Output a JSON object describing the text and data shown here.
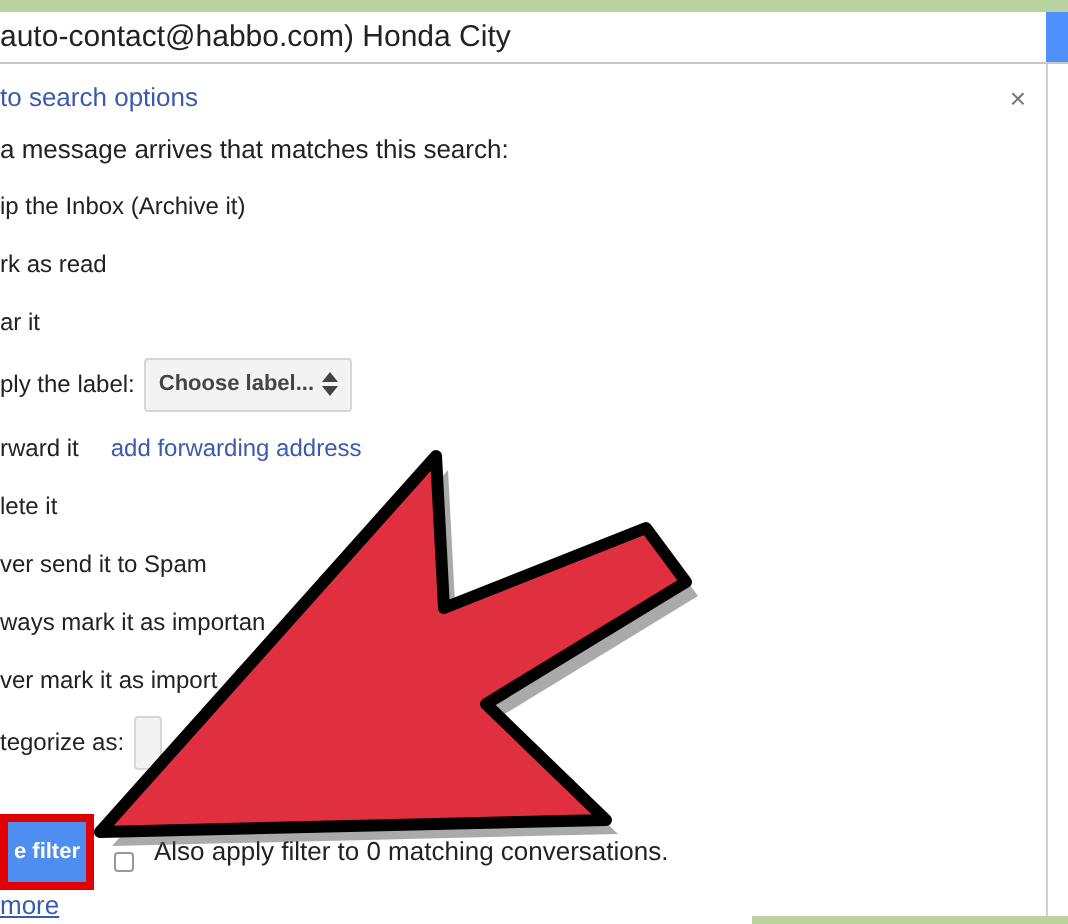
{
  "search": {
    "value": "auto-contact@habbo.com) Honda City"
  },
  "panel": {
    "back_link": "to search options",
    "close": "×",
    "intro": "a message arrives that matches this search:",
    "options": [
      {
        "kind": "text",
        "label": "ip the Inbox (Archive it)"
      },
      {
        "kind": "text",
        "label": "rk as read"
      },
      {
        "kind": "text",
        "label": "ar it"
      },
      {
        "kind": "select",
        "label": "ply the label:",
        "select": "Choose label..."
      },
      {
        "kind": "link",
        "label": "rward it",
        "link": "add forwarding address"
      },
      {
        "kind": "text",
        "label": "lete it"
      },
      {
        "kind": "text",
        "label": "ver send it to Spam"
      },
      {
        "kind": "text",
        "label": "ways mark it as importan"
      },
      {
        "kind": "text",
        "label": "ver mark it as import"
      },
      {
        "kind": "select",
        "label": "tegorize as:"
      }
    ],
    "create_button": "e filter",
    "apply_checkbox": {
      "label": "Also apply filter to 0 matching conversations.",
      "checked": false
    },
    "more_link": "more"
  }
}
